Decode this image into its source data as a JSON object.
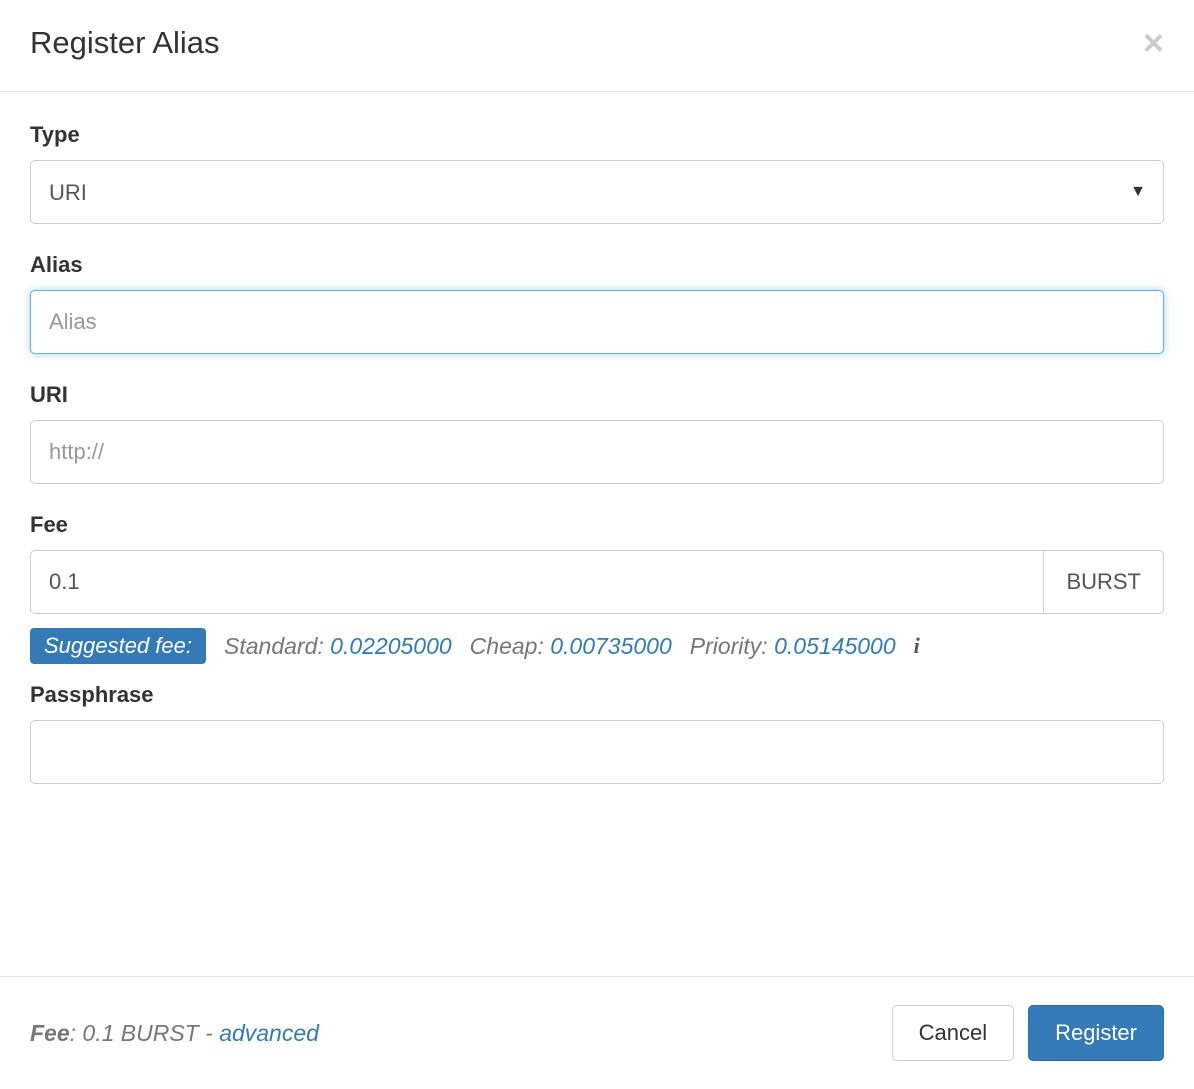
{
  "modal": {
    "title": "Register Alias"
  },
  "form": {
    "type": {
      "label": "Type",
      "value": "URI"
    },
    "alias": {
      "label": "Alias",
      "placeholder": "Alias",
      "value": ""
    },
    "uri": {
      "label": "URI",
      "placeholder": "http://",
      "value": ""
    },
    "fee": {
      "label": "Fee",
      "value": "0.1",
      "unit": "BURST",
      "suggested_label": "Suggested fee:",
      "standard": {
        "label": "Standard:",
        "value": "0.02205000"
      },
      "cheap": {
        "label": "Cheap:",
        "value": "0.00735000"
      },
      "priority": {
        "label": "Priority:",
        "value": "0.05145000"
      }
    },
    "passphrase": {
      "label": "Passphrase",
      "value": ""
    }
  },
  "footer": {
    "fee_label": "Fee",
    "fee_text": ": 0.1 BURST - ",
    "advanced_link": "advanced",
    "cancel": "Cancel",
    "register": "Register"
  }
}
